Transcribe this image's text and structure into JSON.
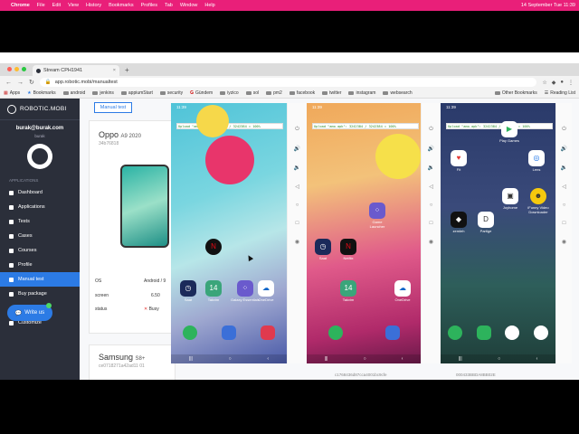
{
  "menubar": {
    "app": "Chrome",
    "items": [
      "File",
      "Edit",
      "View",
      "History",
      "Bookmarks",
      "Profiles",
      "Tab",
      "Window",
      "Help"
    ],
    "datetime": "14 September Tue  11:39"
  },
  "tab": {
    "title": "Stream CPH1941"
  },
  "address": {
    "url": "app.robotic.mobi/manualtest"
  },
  "bookmarks": {
    "items": [
      "Apps",
      "Bookmarks",
      "android",
      "jenkins",
      "appiumStart",
      "security",
      "Gündem",
      "iyzico",
      "sol",
      "pm2",
      "facebook",
      "twitter",
      "instagram",
      "websearch"
    ],
    "other": "Other Bookmarks",
    "reading": "Reading List"
  },
  "sidebar": {
    "brand": "ROBOTIC.MOBI",
    "email": "burak@burak.com",
    "username": "burak",
    "section_apps": "APPLICATIONS",
    "items": [
      "Dashboard",
      "Applications",
      "Tests",
      "Cases",
      "Courses",
      "Profile",
      "Manual test",
      "Buy package"
    ],
    "section_custom": "CUSTOM FUNCTION",
    "custom_items": [
      "Customize"
    ]
  },
  "write_us": "Write us",
  "content": {
    "manual_tag": "Manual test",
    "device1": {
      "brand": "Oppo",
      "model": "A9 2020",
      "id": "34b76818",
      "os_label": "OS",
      "os_value": "Android / 9",
      "screen_label": "screen",
      "screen_value": "6.50",
      "status_label": "status",
      "status_value": "Busy"
    },
    "device2": {
      "brand": "Samsung",
      "model": "S8+",
      "id": "ce0718271a42ad11 01"
    },
    "ids_bottom": [
      "c1768436d87cca4001bc9cfe",
      "000433BBDA8BB02E"
    ]
  },
  "phones": {
    "upload_text": "Upload \"amo.apk\": 3242384 / 3242384 = 100%",
    "phone1": {
      "time": "11:39",
      "dock_labels": [
        "Saat",
        "Takvim",
        "Galaxy Essentials",
        "OneDrive"
      ]
    },
    "phone2": {
      "time": "11:39",
      "labels": [
        "Game Launcher",
        "Saat",
        "Netflix",
        "Takvim",
        "OneDrive"
      ]
    },
    "phone3": {
      "time": "11:39",
      "labels": [
        "Play Games",
        "Fit",
        "Lens",
        "Joyhome",
        "iFunny Video Downloader",
        "zemleh",
        "Partige"
      ]
    }
  },
  "colors": {
    "accent": "#2c7be5",
    "sidebar": "#2b2f3a",
    "menubar": "#e91f79"
  }
}
